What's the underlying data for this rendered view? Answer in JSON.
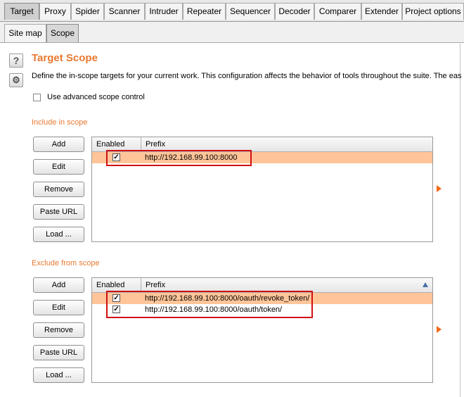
{
  "top_tabs": [
    {
      "label": "Target",
      "active": true
    },
    {
      "label": "Proxy",
      "active": false
    },
    {
      "label": "Spider",
      "active": false
    },
    {
      "label": "Scanner",
      "active": false
    },
    {
      "label": "Intruder",
      "active": false
    },
    {
      "label": "Repeater",
      "active": false
    },
    {
      "label": "Sequencer",
      "active": false
    },
    {
      "label": "Decoder",
      "active": false
    },
    {
      "label": "Comparer",
      "active": false
    },
    {
      "label": "Extender",
      "active": false
    },
    {
      "label": "Project options",
      "active": false
    }
  ],
  "sub_tabs": [
    {
      "label": "Site map",
      "active": false
    },
    {
      "label": "Scope",
      "active": true
    }
  ],
  "side_icons": {
    "help": "question-icon",
    "settings": "gear-icon",
    "help_glyph": "?",
    "settings_glyph": "⚙"
  },
  "scope": {
    "title": "Target Scope",
    "description": "Define the in-scope targets for your current work. This configuration affects the behavior of tools throughout the suite. The eas",
    "advanced_label": "Use advanced scope control",
    "advanced_checked": false
  },
  "include": {
    "heading": "Include in scope",
    "buttons": [
      "Add",
      "Edit",
      "Remove",
      "Paste URL",
      "Load ..."
    ],
    "columns": {
      "enabled": "Enabled",
      "prefix": "Prefix"
    },
    "rows": [
      {
        "enabled": true,
        "prefix": "http://192.168.99.100:8000",
        "selected": true
      }
    ]
  },
  "exclude": {
    "heading": "Exclude from scope",
    "buttons": [
      "Add",
      "Edit",
      "Remove",
      "Paste URL",
      "Load ..."
    ],
    "columns": {
      "enabled": "Enabled",
      "prefix": "Prefix"
    },
    "rows": [
      {
        "enabled": true,
        "prefix": "http://192.168.99.100:8000/oauth/revoke_token/",
        "selected": true
      },
      {
        "enabled": true,
        "prefix": "http://192.168.99.100:8000/oauth/token/",
        "selected": false
      }
    ]
  },
  "colors": {
    "accent": "#e87830",
    "selection": "#ffc599",
    "highlight": "#d01010",
    "arrow": "#f26a1b"
  }
}
